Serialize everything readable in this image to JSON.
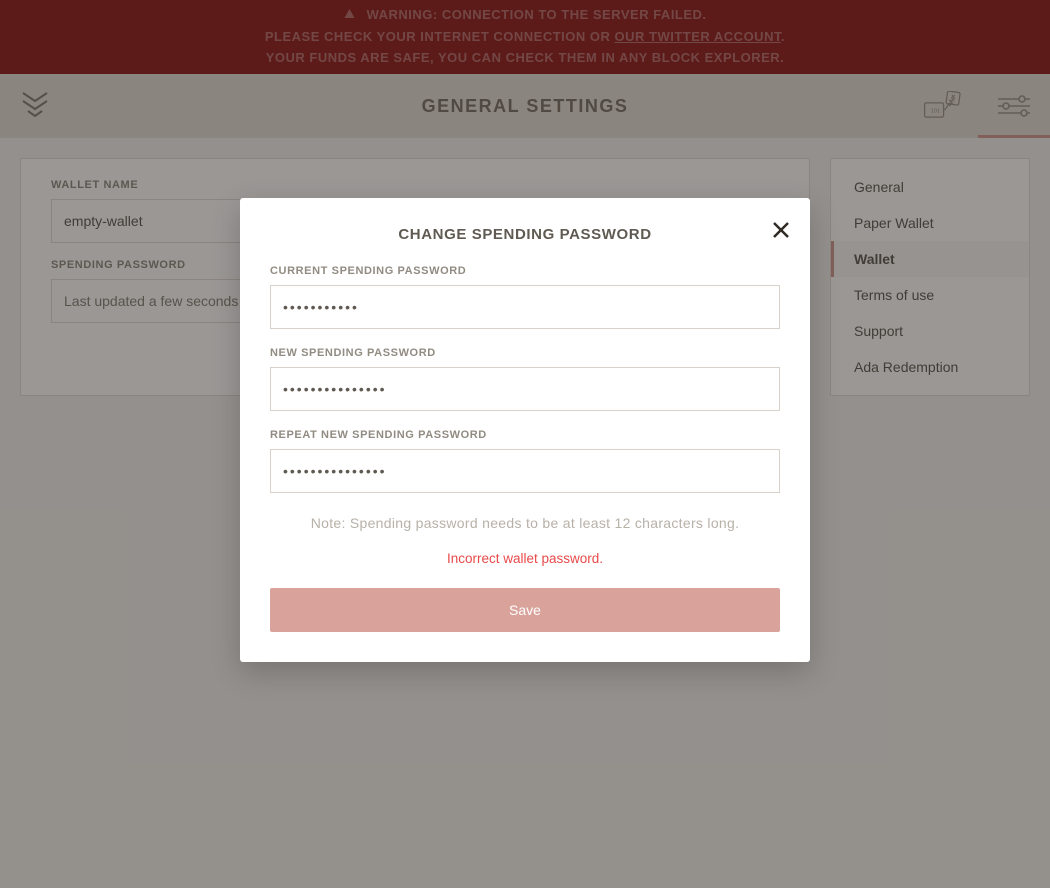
{
  "banner": {
    "line1": "WARNING: CONNECTION TO THE SERVER FAILED.",
    "line2_prefix": "PLEASE CHECK YOUR INTERNET CONNECTION OR ",
    "line2_link": "OUR TWITTER ACCOUNT",
    "line2_suffix": ".",
    "line3": "YOUR FUNDS ARE SAFE, YOU CAN CHECK THEM IN ANY BLOCK EXPLORER."
  },
  "header": {
    "title": "GENERAL SETTINGS"
  },
  "main": {
    "wallet_name_label": "WALLET NAME",
    "wallet_name_value": "empty-wallet",
    "spending_password_label": "SPENDING PASSWORD",
    "spending_password_status": "Last updated a few seconds ago"
  },
  "sidebar": {
    "items": [
      {
        "label": "General",
        "active": false
      },
      {
        "label": "Paper Wallet",
        "active": false
      },
      {
        "label": "Wallet",
        "active": true
      },
      {
        "label": "Terms of use",
        "active": false
      },
      {
        "label": "Support",
        "active": false
      },
      {
        "label": "Ada Redemption",
        "active": false
      }
    ]
  },
  "modal": {
    "title": "CHANGE SPENDING PASSWORD",
    "current_label": "CURRENT SPENDING PASSWORD",
    "current_value": "•••••••••••",
    "new_label": "NEW SPENDING PASSWORD",
    "new_value": "•••••••••••••••",
    "repeat_label": "REPEAT NEW SPENDING PASSWORD",
    "repeat_value": "•••••••••••••••",
    "note": "Note: Spending password needs to be at least 12 characters long.",
    "error": "Incorrect wallet password.",
    "save_label": "Save"
  },
  "colors": {
    "accent": "#d39a93",
    "banner_bg": "#8f1e1e",
    "error": "#e84a4a"
  }
}
